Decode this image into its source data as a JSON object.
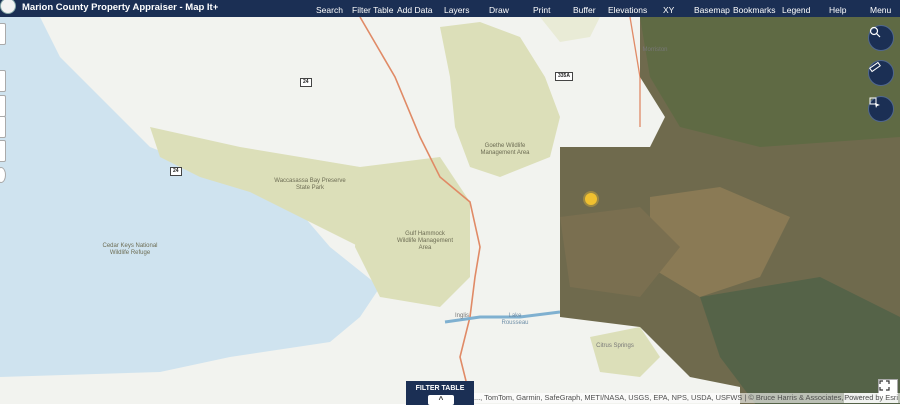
{
  "app": {
    "title": "Marion County Property Appraiser - Map It+"
  },
  "menu": [
    {
      "label": "Search"
    },
    {
      "label": "Filter Table"
    },
    {
      "label": "Add Data"
    },
    {
      "label": "Layers"
    },
    {
      "label": "Draw"
    },
    {
      "label": "Print"
    },
    {
      "label": "Buffer"
    },
    {
      "label": "Elevations"
    },
    {
      "label": "XY"
    },
    {
      "label": "Basemap"
    },
    {
      "label": "Bookmarks"
    },
    {
      "label": "Legend"
    },
    {
      "label": "Help"
    },
    {
      "label": "Menu"
    }
  ],
  "map": {
    "labels": {
      "waccasassa": "Waccasassa Bay Preserve State Park",
      "goethe": "Goethe Wildlife Management Area",
      "gulf_hammock": "Gulf Hammock Wildlife Management Area",
      "cedar_keys": "Cedar Keys National Wildlife Refuge",
      "lake_rousseau": "Lake Rousseau",
      "inglis": "Inglis",
      "citrus_springs": "Citrus Springs",
      "morriston": "Morriston"
    },
    "route_shields": {
      "r24_top": "24",
      "r24_bottom": "24",
      "r335a": "335A"
    }
  },
  "widgets": {
    "filter_table_label": "FILTER TABLE",
    "collapse_chevron": "^"
  },
  "attribution": {
    "text": "..., TomTom, Garmin, SafeGraph, METI/NASA, USGS, EPA, NPS, USDA, USFWS | © Bruce Harris & Associates, 2024",
    "powered_by": "Powered by Esri"
  },
  "colors": {
    "header": "#1b2f54",
    "water": "#cfe3ef",
    "land": "#f2f3ef",
    "park": "#dcdfb9",
    "road": "#e08a66",
    "imagery": "#6f6a4d"
  },
  "icons": {
    "zoom_search": "magnifier-icon",
    "measure": "ruler-icon",
    "identify": "identify-icon",
    "expand": "expand-icon",
    "sun": "sun-icon",
    "logo": "seal-icon"
  }
}
